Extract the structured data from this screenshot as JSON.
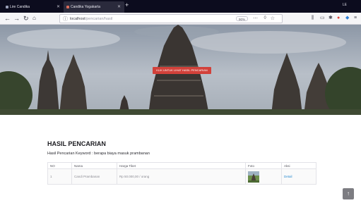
{
  "browser": {
    "tabs": [
      {
        "label": "Lire Candika"
      },
      {
        "label": "Candika Yogakarta"
      }
    ],
    "new_tab": "+",
    "window_controls": "LE",
    "url_host": "localhost",
    "url_path": "/pencarian/hasil",
    "zoom": "90%",
    "nav_icons": [
      "back-arrow-icon",
      "forward-arrow-icon",
      "reload-icon",
      "home-icon"
    ],
    "toolbar_icons": [
      "library-icon",
      "sidebar-icon",
      "extension-icon",
      "addon-red-icon",
      "addon-blue-icon",
      "menu-icon"
    ]
  },
  "hero": {
    "button_label": "KLIK UNTUK LIHAT HASIL PENCARIAN"
  },
  "results": {
    "title": "HASIL PENCARIAN",
    "subtitle": "Hasil Pencarian Keyword : berapa biaya masuk prambanan",
    "headers": [
      "NO",
      "Nama",
      "Harga Tiket",
      "Foto",
      "Aksi"
    ],
    "rows": [
      {
        "no": "1",
        "nama": "Candi Prambanan",
        "harga": "Rp 50.000,00 / orang",
        "aksi": "Detail"
      }
    ]
  },
  "scroll_top_label": "↑",
  "colors": {
    "tabbar": "#0c0c1e",
    "hero_button": "#d2413a",
    "link": "#2a8bd0"
  }
}
